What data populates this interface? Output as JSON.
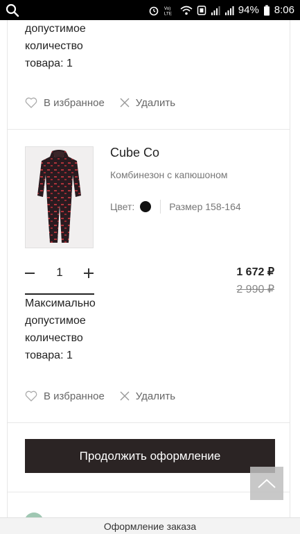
{
  "status_bar": {
    "battery": "94%",
    "time": "8:06",
    "icons": [
      "search-icon",
      "alarm-icon",
      "volte-icon",
      "wifi-icon",
      "nfc-icon",
      "signal-icon",
      "signal-icon",
      "battery-icon"
    ]
  },
  "cart": {
    "previous_item": {
      "limit_lines": [
        "допустимое",
        "количество",
        "товара: 1"
      ],
      "favorite_label": "В избранное",
      "delete_label": "Удалить"
    },
    "item": {
      "brand": "Cube Co",
      "name": "Комбинезон с капюшоном",
      "color_label": "Цвет:",
      "color_hex": "#111111",
      "size_label": "Размер 158-164",
      "quantity": "1",
      "price": "1 672 ₽",
      "old_price": "2 990 ₽",
      "limit_lines": [
        "Максимально",
        "допустимое",
        "количество",
        "товара: 1"
      ],
      "favorite_label": "В избранное",
      "delete_label": "Удалить"
    }
  },
  "checkout": {
    "button_label": "Продолжить оформление"
  },
  "footer": {
    "title": "Оформление заказа"
  },
  "colors": {
    "button_bg": "#2b2424",
    "text_muted": "#777777"
  }
}
